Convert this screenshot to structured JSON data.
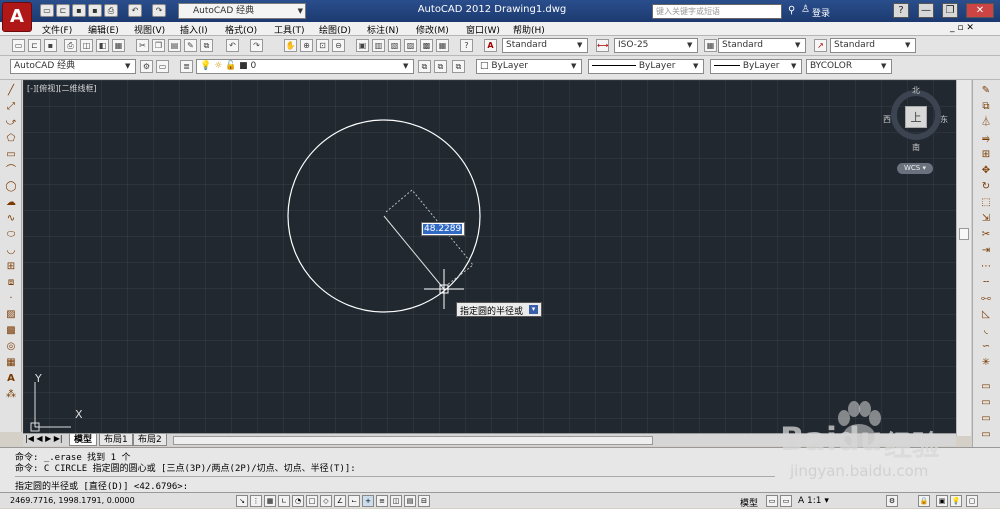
{
  "app": {
    "logo_letter": "A",
    "title": "AutoCAD 2012    Drawing1.dwg",
    "workspace": "AutoCAD 经典",
    "search_placeholder": "键入关键字或短语",
    "login": "登录"
  },
  "quick_access": [
    "new",
    "open",
    "save",
    "saveas",
    "plot",
    "undo",
    "redo"
  ],
  "window_buttons": [
    "?",
    "—",
    "❐",
    "✕"
  ],
  "menu": [
    "文件(F)",
    "编辑(E)",
    "视图(V)",
    "插入(I)",
    "格式(O)",
    "工具(T)",
    "绘图(D)",
    "标注(N)",
    "修改(M)",
    "窗口(W)",
    "帮助(H)"
  ],
  "styles": {
    "text_style": "Standard",
    "dim_style": "ISO-25",
    "table_style": "Standard",
    "multileader_style": "Standard"
  },
  "layers": {
    "workspace": "AutoCAD 经典",
    "current_layer": "0",
    "color": "ByLayer",
    "linetype": "ByLayer",
    "lineweight": "ByLayer",
    "plotstyle": "BYCOLOR"
  },
  "viewport": {
    "label": "[-][俯视][二维线框]",
    "radius_input": "48.2289",
    "tooltip": "指定圆的半径或"
  },
  "viewcube": {
    "north": "北",
    "south": "南",
    "east": "东",
    "west": "西",
    "top": "上",
    "wcs": "WCS"
  },
  "ucs": {
    "x": "X",
    "y": "Y"
  },
  "tabs": [
    "模型",
    "布局1",
    "布局2"
  ],
  "command_history": [
    "命令: _.erase 找到 1 个",
    "命令: C CIRCLE 指定圆的圆心或 [三点(3P)/两点(2P)/切点、切点、半径(T)]:"
  ],
  "command_prompt": "指定圆的半径或 [直径(D)] <42.6796>:",
  "status": {
    "coords": "2469.7716, 1998.1791, 0.0000",
    "model": "模型",
    "scale": "1:1"
  },
  "watermark": {
    "brand": "Baidu",
    "cn": "经验",
    "url": "jingyan.baidu.com"
  },
  "colors": {
    "canvas": "#212830",
    "title": "#1c3a70",
    "logo": "#b01818"
  }
}
